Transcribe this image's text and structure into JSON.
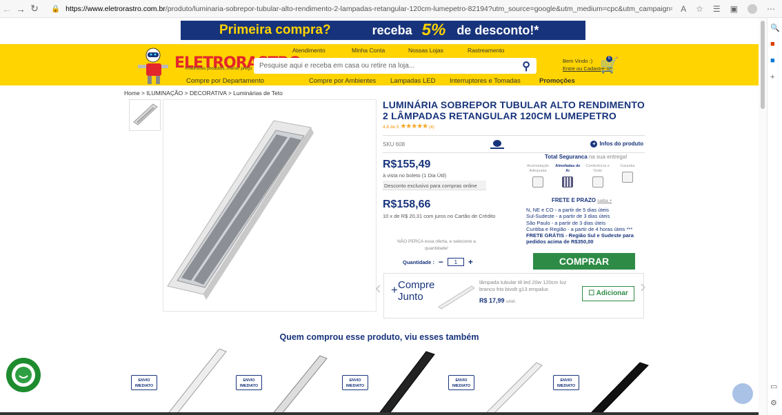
{
  "browser": {
    "url_host": "https://www.eletrorastro.com.br",
    "url_path": "/produto/luminaria-sobrepor-tubular-alto-rendimento-2-lampadas-retangular-120cm-lumepetro-82194?utm_source=google&utm_medium=cpc&utm_campaign=&srsltid=AYJSbAdhrkk1M8oC_c_lmNu-..."
  },
  "promo": {
    "part1": "Primeira compra?",
    "part2": "receba",
    "part3": "5%",
    "part4": "de desconto!*"
  },
  "header": {
    "links": [
      "Atendimento",
      "Minha Conta",
      "Nossas Lojas",
      "Rastreamento"
    ],
    "logo": "ELETRORASTRO",
    "logo_sub": "#melhores produtos, menor preço",
    "search_placeholder": "Pesquise aqui e receba em casa ou retire na loja...",
    "welcome": "Bem Vindo :)",
    "login": "Entre ou Cadastre-se",
    "cart_count": "0"
  },
  "menu": [
    "Compre por Departamento",
    "Compre por Ambientes",
    "Lampadas LED",
    "Interruptores e Tomadas",
    "Promoções"
  ],
  "breadcrumb": "Home > ILUMINAÇÃO > DECORATIVA > Luminárias de Teto",
  "product": {
    "title": "LUMINÁRIA SOBREPOR TUBULAR ALTO RENDIMENTO 2 LÂMPADAS RETANGULAR 120CM LUMEPETRO",
    "rating_text": "4.8 de 5",
    "rating_stars": "★★★★★",
    "rating_count": "(4)",
    "sku": "SKU 608",
    "infos": "Infos do produto",
    "price_boleto": "R$155,49",
    "boleto_note": "à vista no boleto (1 Dia Útil)",
    "boleto_desc": "Desconto exclusivo para compras online",
    "price_card": "R$158,66",
    "card_note": "10 x de R$ 20,31 com juros no Cartão de Crédito",
    "offer_note": "NÃO PERCA essa oferta, e selecione a quantidade!",
    "qty_label": "Quantidade :",
    "qty_value": "1",
    "buy": "COMPRAR"
  },
  "security": {
    "title_bold": "Total Seguranca",
    "title_rest": "na sua entrega!",
    "items": [
      "Acomodação Adequada",
      "Almofadas de Ar",
      "Conferência e Teste",
      "Garantia"
    ]
  },
  "shipping": {
    "title": "FRETE E PRAZO",
    "link": "saiba +",
    "lines": [
      "N, NE e CO - a partir de 5 dias úteis",
      "Sul-Sudeste - a partir de 3 dias úteis",
      "São Paulo - a partir de 3 dias úteis",
      "Curitiba e Região - a partir de 4 horas úteis ***"
    ],
    "free": "FRETE GRÁTIS - Região Sul e Sudeste para pedidos acima de R$350,00"
  },
  "combo": {
    "title1": "Compre",
    "title2": "Junto",
    "name": "lâmpada tubular t8 led 20w 120cm luz branco frio bivolt g13 empalux",
    "price": "R$ 17,99",
    "unit": "unid.",
    "add": "Adicionar"
  },
  "related": {
    "title": "Quem comprou esse produto, viu esses também",
    "badge_line1": "ENVIO",
    "badge_line2": "IMEDIATO"
  }
}
